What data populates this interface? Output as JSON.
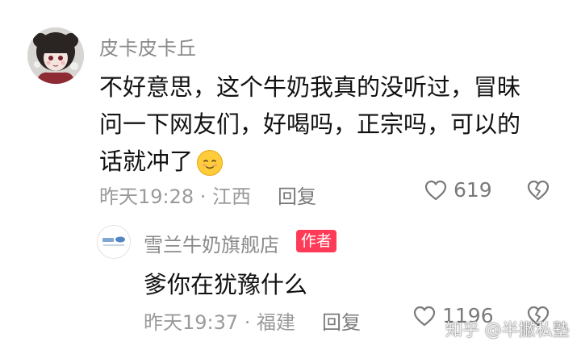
{
  "comment": {
    "username": "皮卡皮卡丘",
    "text_lines": [
      "不好意思，这个牛奶我真的没听过，冒昧",
      "问一下网友们，好喝吗，正宗吗，可以的",
      "话就冲了"
    ],
    "emoji": "smiling-face-emoji",
    "time_location": "昨天19:28 · 江西",
    "reply_label": "回复",
    "likes": "619"
  },
  "reply": {
    "shop_name": "雪兰牛奶旗舰店",
    "author_badge": "作者",
    "text": "爹你在犹豫什么",
    "time_location": "昨天19:37 · 福建",
    "reply_label": "回复",
    "likes": "1196"
  },
  "watermark": "知乎 @半撇私塾",
  "colors": {
    "badge": "#ff3b57",
    "meta_gray": "#9a9a9a"
  }
}
